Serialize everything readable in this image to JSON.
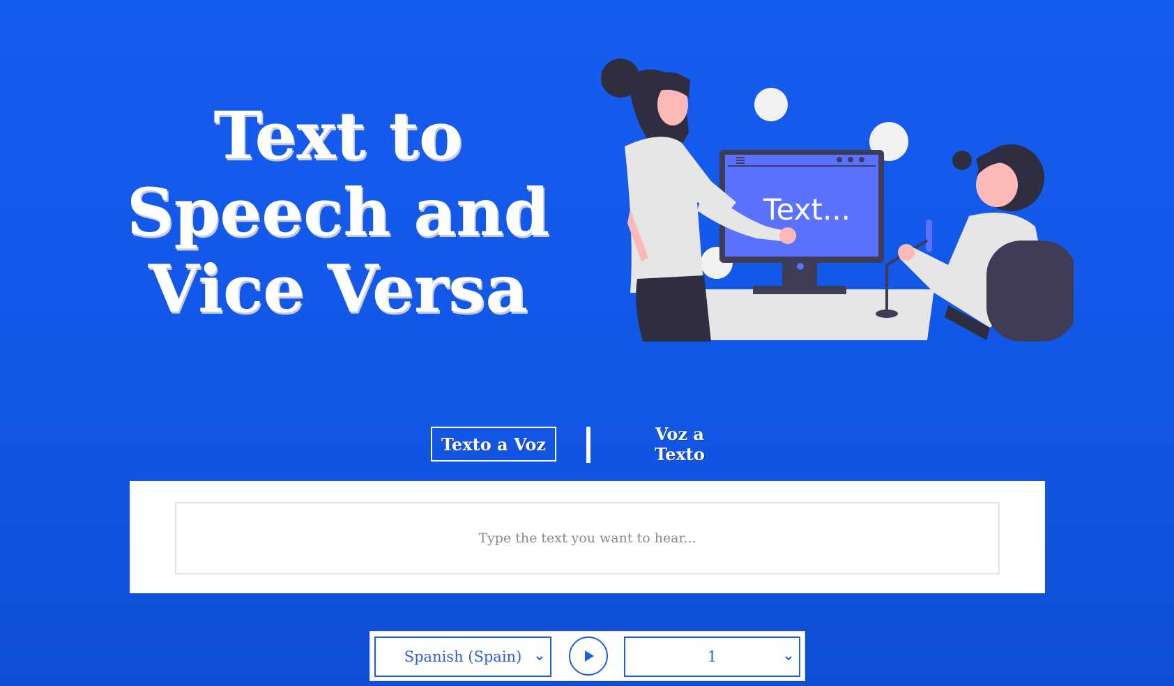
{
  "hero": {
    "title_line1": "Text to",
    "title_line2": "Speech and",
    "title_line3": "Vice Versa",
    "illustration_text": "Text..."
  },
  "tabs": [
    {
      "label": "Texto a Voz",
      "active": true
    },
    {
      "label": "Voz a Texto",
      "active": false
    }
  ],
  "text_input": {
    "value": "",
    "placeholder": "Type the text you want to hear..."
  },
  "controls": {
    "language": "Spanish (Spain)",
    "rate": "1",
    "play_icon": "play-icon",
    "dropdown_icon": "chevron-down-icon"
  },
  "colors": {
    "background": "#155cf0",
    "accent": "#1a5de8",
    "panel": "#ffffff"
  }
}
